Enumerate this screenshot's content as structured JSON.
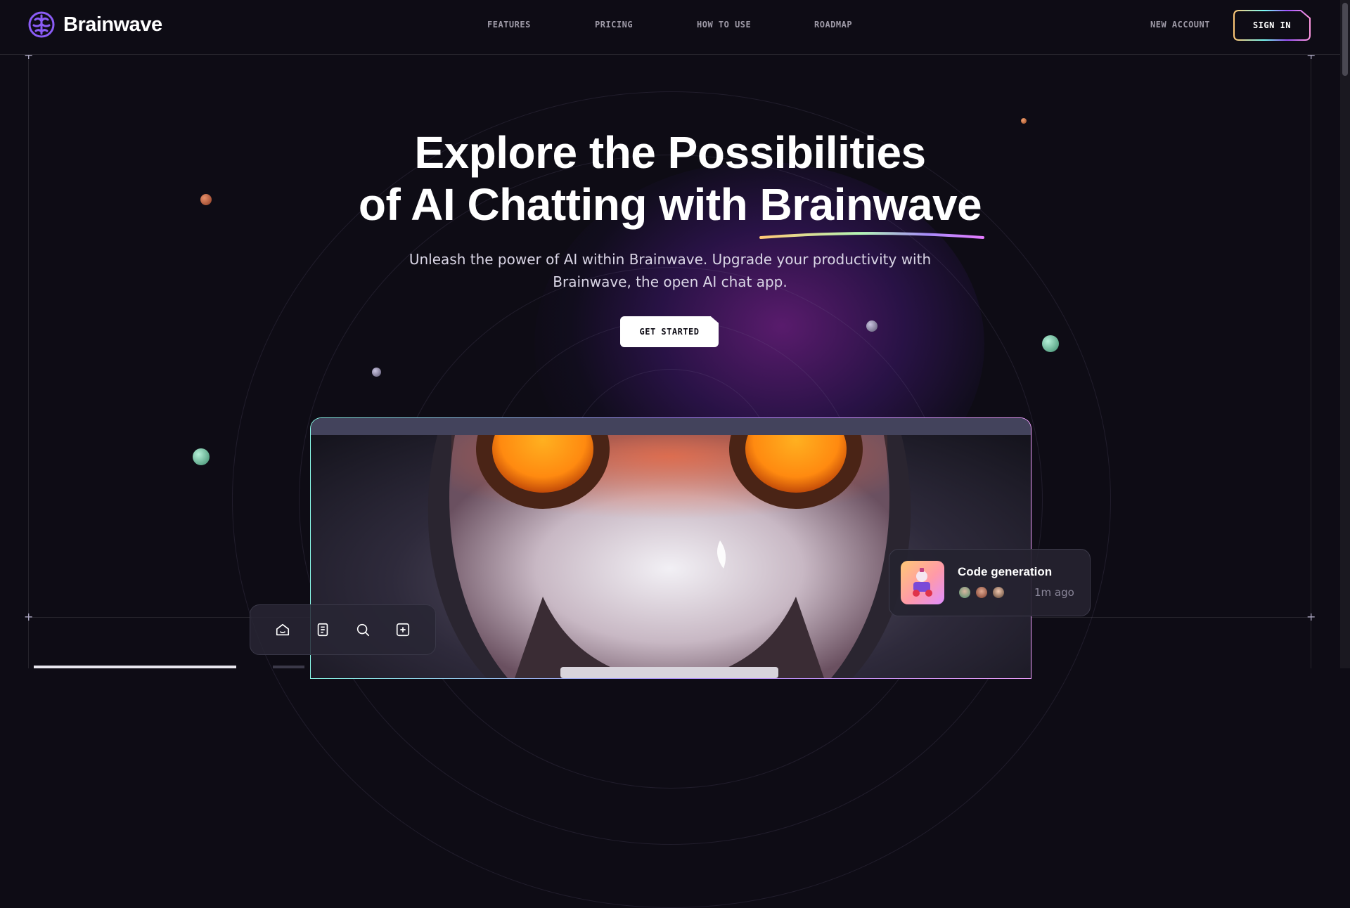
{
  "header": {
    "brand": "Brainwave",
    "nav": [
      "FEATURES",
      "PRICING",
      "HOW TO USE",
      "ROADMAP"
    ],
    "new_account": "NEW ACCOUNT",
    "sign_in": "SIGN IN"
  },
  "hero": {
    "title_line1": "Explore the Possibilities",
    "title_line2_prefix": "of AI Chatting with ",
    "title_highlight": "Brainwave",
    "subtitle_line1": "Unleash the power of AI within Brainwave. Upgrade your productivity with",
    "subtitle_line2": "Brainwave, the open AI chat app.",
    "cta": "GET STARTED"
  },
  "toolbar": {
    "icons": [
      "home-icon",
      "document-icon",
      "search-icon",
      "add-icon"
    ]
  },
  "notification": {
    "title": "Code generation",
    "time": "1m ago"
  },
  "colors": {
    "background": "#0e0c15",
    "accent_purple": "#a78bfa",
    "accent_teal": "#89f9e8",
    "accent_yellow": "#ffc876",
    "accent_pink": "#f0a0ff"
  }
}
